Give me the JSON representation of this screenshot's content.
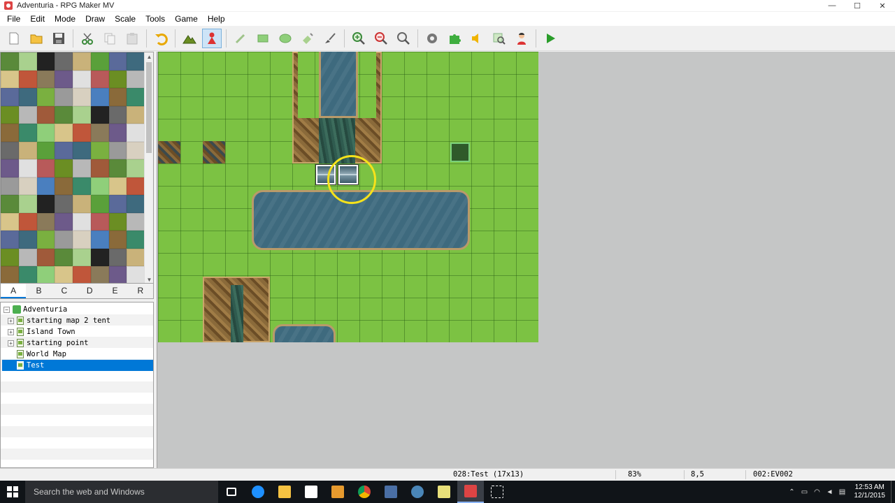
{
  "window": {
    "title": "Adventuria - RPG Maker MV",
    "min": "—",
    "max": "☐",
    "close": "✕"
  },
  "menu": [
    "File",
    "Edit",
    "Mode",
    "Draw",
    "Scale",
    "Tools",
    "Game",
    "Help"
  ],
  "toolbar": {
    "buttons": [
      "new-project",
      "open-project",
      "save-project",
      "cut",
      "copy",
      "paste",
      "undo",
      "map-mode",
      "event-mode",
      "pencil",
      "rectangle",
      "ellipse",
      "fill",
      "shadow-pen",
      "zoom-in",
      "zoom-out",
      "actual-size",
      "database",
      "plugin-manager",
      "sound-test",
      "event-searcher",
      "character-generator",
      "playtest"
    ],
    "active": "event-mode"
  },
  "tileset": {
    "tabs": [
      "A",
      "B",
      "C",
      "D",
      "E",
      "R"
    ],
    "active_tab": "A"
  },
  "map_tree": {
    "root": "Adventuria",
    "items": [
      {
        "label": "starting map 2 tent",
        "expandable": true
      },
      {
        "label": "Island Town",
        "expandable": true
      },
      {
        "label": "starting point",
        "expandable": true
      },
      {
        "label": "World Map",
        "expandable": false
      },
      {
        "label": "Test",
        "expandable": false,
        "selected": true
      }
    ]
  },
  "statusbar": {
    "map": "028:Test (17x13)",
    "zoom": "83%",
    "coords": "8,5",
    "event": "002:EV002"
  },
  "taskbar": {
    "search_placeholder": "Search the web and Windows",
    "time": "12:53 AM",
    "date": "12/1/2015"
  },
  "colors": {
    "grass": "#7cc243",
    "water": "#3e6a7e",
    "selection": "#0078d7",
    "highlight_ring": "#f5e21b"
  }
}
